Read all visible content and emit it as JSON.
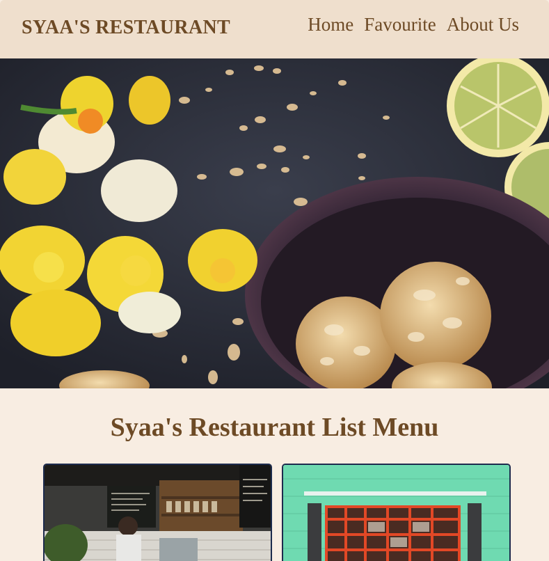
{
  "navbar": {
    "brand": "SYAA'S RESTAURANT",
    "links": [
      "Home",
      "Favourite",
      "About Us"
    ]
  },
  "hero": {
    "image": "dark table with yellow daffodils, almond cookies in a bowl and lemon slices"
  },
  "menu": {
    "title": "Syaa's Restaurant List Menu",
    "cards": [
      {
        "image": "cafe interior with barista and chalkboard"
      },
      {
        "image": "green storefront with red-framed window"
      }
    ]
  },
  "colors": {
    "navbar_bg": "#efdfcd",
    "page_bg": "#f8ede2",
    "text_brown": "#6d4a25"
  }
}
